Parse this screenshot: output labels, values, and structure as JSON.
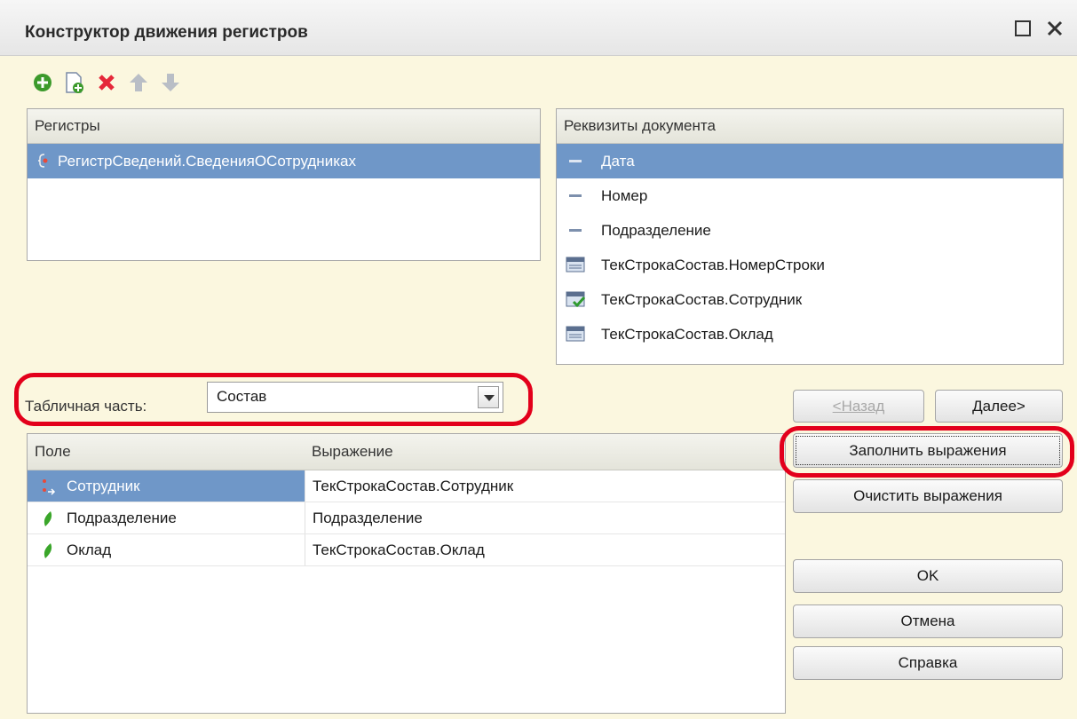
{
  "window": {
    "title": "Конструктор движения регистров"
  },
  "toolbar": {
    "icons": [
      "add-icon",
      "add-copy-icon",
      "delete-icon",
      "move-up-icon",
      "move-down-icon"
    ]
  },
  "registers": {
    "header": "Регистры",
    "items": [
      {
        "label": "РегистрСведений.СведенияОСотрудниках",
        "selected": true
      }
    ]
  },
  "doc_attrs": {
    "header": "Реквизиты документа",
    "items": [
      {
        "label": "Дата",
        "icon": "attribute-icon",
        "selected": true
      },
      {
        "label": "Номер",
        "icon": "attribute-icon"
      },
      {
        "label": "Подразделение",
        "icon": "attribute-icon"
      },
      {
        "label": "ТекСтрокаСостав.НомерСтроки",
        "icon": "tabular-attribute-icon"
      },
      {
        "label": "ТекСтрокаСостав.Сотрудник",
        "icon": "tabular-attribute-check-icon"
      },
      {
        "label": "ТекСтрокаСостав.Оклад",
        "icon": "tabular-attribute-icon"
      }
    ]
  },
  "tabular": {
    "label": "Табличная часть:",
    "value": "Состав"
  },
  "nav": {
    "back": "<Назад",
    "next": "Далее>"
  },
  "actions": {
    "fill": "Заполнить выражения",
    "clear": "Очистить выражения",
    "ok": "OK",
    "cancel": "Отмена",
    "help": "Справка"
  },
  "grid": {
    "columns": [
      "Поле",
      "Выражение"
    ],
    "rows": [
      {
        "field": "Сотрудник",
        "expr": "ТекСтрокаСостав.Сотрудник",
        "icon": "dimension-icon",
        "selected": true
      },
      {
        "field": "Подразделение",
        "expr": "Подразделение",
        "icon": "resource-icon"
      },
      {
        "field": "Оклад",
        "expr": "ТекСтрокаСостав.Оклад",
        "icon": "resource-icon"
      }
    ]
  },
  "colors": {
    "selection": "#6f97c8",
    "highlight_ring": "#e3001b"
  }
}
